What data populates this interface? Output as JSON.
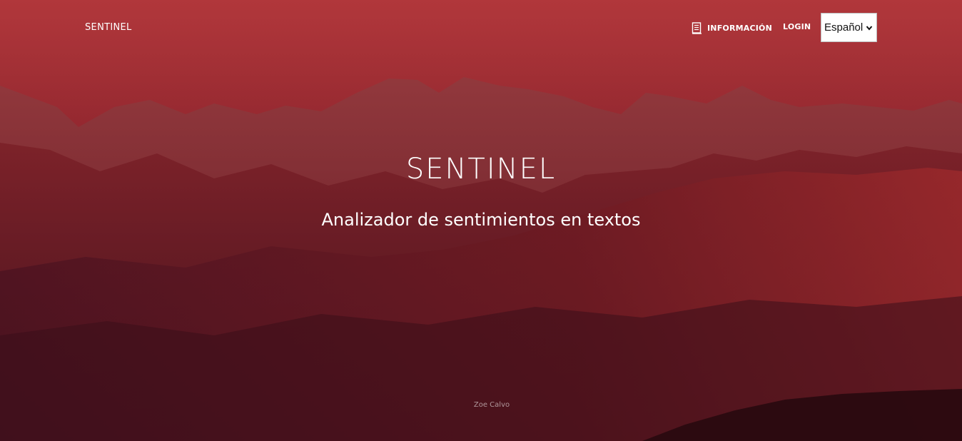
{
  "nav": {
    "brand": "SENTINEL",
    "info_label": "INFORMACIÓN",
    "info_icon": "document-icon",
    "login_label": "LOGIN",
    "language": {
      "selected": "Español"
    }
  },
  "hero": {
    "title": "SENTINEL",
    "subtitle": "Analizador de sentimientos en textos"
  },
  "footer": {
    "credit": "Zoe Calvo"
  },
  "colors": {
    "overlay": "#8e2630",
    "text": "#ffffff"
  }
}
